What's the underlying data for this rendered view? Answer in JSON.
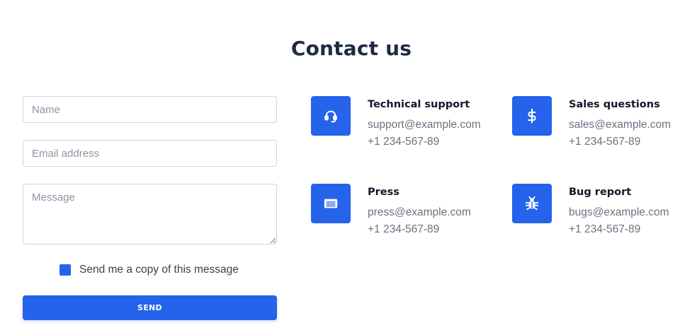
{
  "page": {
    "title": "Contact us"
  },
  "form": {
    "name_placeholder": "Name",
    "email_placeholder": "Email address",
    "message_placeholder": "Message",
    "copy_label": "Send me a copy of this message",
    "copy_checked": true,
    "send_label": "SEND"
  },
  "contacts": [
    {
      "title": "Technical support",
      "email": "support@example.com",
      "phone": "+1 234-567-89",
      "icon": "headset-icon"
    },
    {
      "title": "Sales questions",
      "email": "sales@example.com",
      "phone": "+1 234-567-89",
      "icon": "dollar-icon"
    },
    {
      "title": "Press",
      "email": "press@example.com",
      "phone": "+1 234-567-89",
      "icon": "newspaper-icon"
    },
    {
      "title": "Bug report",
      "email": "bugs@example.com",
      "phone": "+1 234-567-89",
      "icon": "bug-icon"
    }
  ],
  "colors": {
    "accent": "#2563eb",
    "heading": "#1f2a44",
    "muted_text": "#6b7280"
  }
}
